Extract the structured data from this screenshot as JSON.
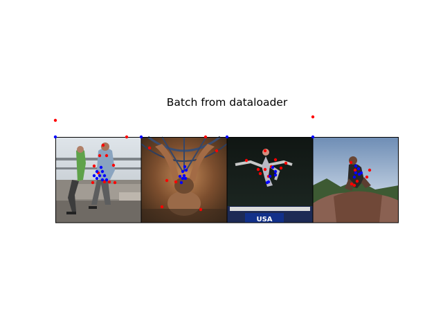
{
  "chart_data": {
    "type": "scatter",
    "title": "Batch from dataloader",
    "panels": [
      {
        "label": "",
        "scene": "two men on concrete ledge",
        "keypoints_red": [
          [
            0,
            -24
          ],
          [
            103,
            0
          ],
          [
            69,
            12
          ],
          [
            64,
            27
          ],
          [
            74,
            27
          ],
          [
            84,
            41
          ],
          [
            56,
            42
          ],
          [
            62,
            52
          ],
          [
            54,
            66
          ],
          [
            71,
            65
          ],
          [
            78,
            65
          ],
          [
            86,
            66
          ]
        ],
        "keypoints_blue": [
          [
            0,
            0
          ],
          [
            66,
            44
          ],
          [
            60,
            50
          ],
          [
            68,
            50
          ],
          [
            56,
            56
          ],
          [
            64,
            56
          ],
          [
            71,
            56
          ],
          [
            60,
            60
          ],
          [
            68,
            62
          ],
          [
            74,
            62
          ]
        ]
      },
      {
        "label": "",
        "scene": "person falling in rides",
        "keypoints_red": [
          [
            93,
            0
          ],
          [
            12,
            16
          ],
          [
            109,
            20
          ],
          [
            37,
            63
          ],
          [
            50,
            65
          ],
          [
            30,
            101
          ],
          [
            86,
            105
          ]
        ],
        "keypoints_blue": [
          [
            0,
            0
          ],
          [
            124,
            0
          ],
          [
            63,
            43
          ],
          [
            60,
            50
          ],
          [
            65,
            48
          ],
          [
            56,
            57
          ],
          [
            60,
            60
          ],
          [
            62,
            56
          ],
          [
            64,
            60
          ],
          [
            58,
            66
          ]
        ]
      },
      {
        "label": "",
        "scene": "gymnast on beam",
        "keypoints_red": [
          [
            55,
            20
          ],
          [
            28,
            34
          ],
          [
            45,
            47
          ],
          [
            55,
            47
          ],
          [
            70,
            33
          ],
          [
            85,
            38
          ],
          [
            78,
            45
          ],
          [
            48,
            53
          ],
          [
            60,
            57
          ],
          [
            64,
            43
          ]
        ],
        "keypoints_blue": [
          [
            66,
            44
          ],
          [
            70,
            50
          ],
          [
            58,
            66
          ],
          [
            62,
            57
          ],
          [
            70,
            55
          ],
          [
            60,
            65
          ]
        ]
      },
      {
        "label": "",
        "scene": "boy on rock",
        "keypoints_red": [
          [
            0,
            -29
          ],
          [
            55,
            37
          ],
          [
            61,
            48
          ],
          [
            78,
            58
          ],
          [
            64,
            64
          ],
          [
            56,
            68
          ],
          [
            60,
            70
          ],
          [
            82,
            48
          ]
        ],
        "keypoints_blue": [
          [
            0,
            0
          ],
          [
            62,
            42
          ],
          [
            66,
            46
          ],
          [
            62,
            52
          ],
          [
            70,
            52
          ],
          [
            67,
            54
          ],
          [
            60,
            58
          ]
        ]
      }
    ],
    "grid": false,
    "legend": "none",
    "colors": {
      "red": "#ff0000",
      "blue": "#0000ff",
      "frame": "#000000"
    }
  }
}
